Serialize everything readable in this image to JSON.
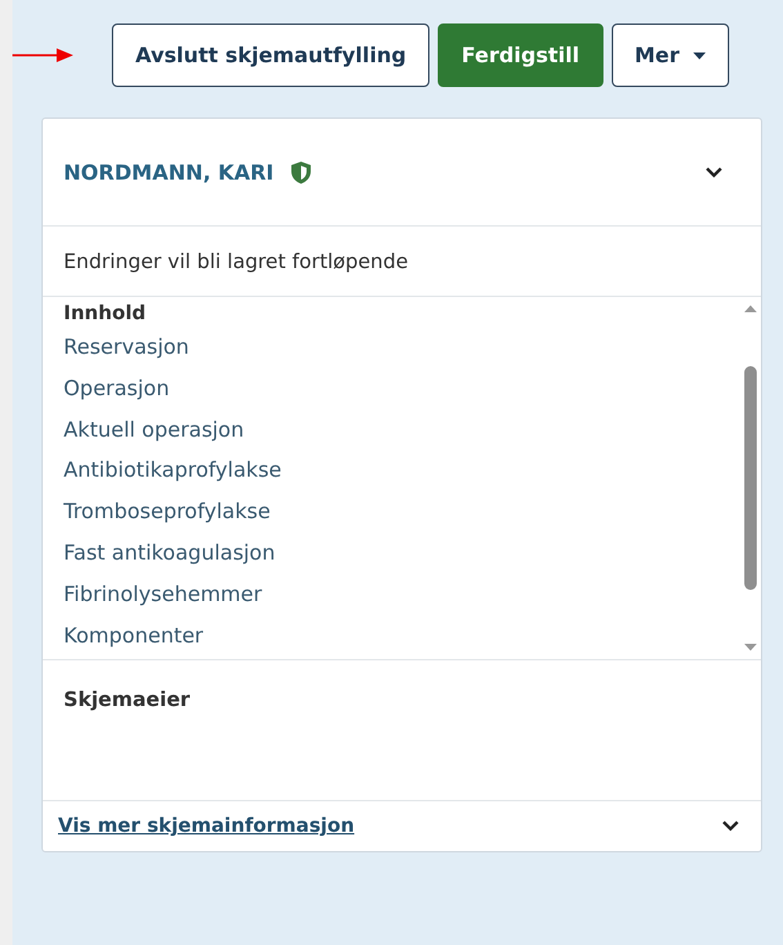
{
  "toolbar": {
    "buttons": [
      {
        "label": "Avslutt skjemautfylling",
        "kind": "outline"
      },
      {
        "label": "Ferdigstill",
        "kind": "primary"
      },
      {
        "label": "Mer",
        "kind": "dropdown"
      }
    ]
  },
  "card": {
    "patient_name": "NORDMANN, KARI",
    "expanded": false,
    "notice": "Endringer vil bli lagret fortløpende",
    "contents": {
      "heading": "Innhold",
      "items": [
        "Reservasjon",
        "Operasjon",
        "Aktuell operasjon",
        "Antibiotikaprofylakse",
        "Tromboseprofylakse",
        "Fast antikoagulasjon",
        "Fibrinolysehemmer",
        "Komponenter"
      ]
    },
    "owner_label": "Skjemaeier",
    "more_link": "Vis mer skjemainformasjon"
  }
}
